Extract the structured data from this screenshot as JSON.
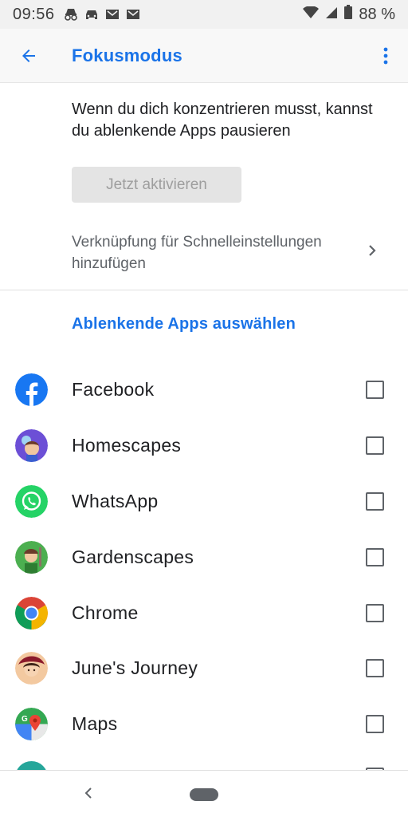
{
  "status_bar": {
    "time": "09:56",
    "battery": "88 %",
    "icons": [
      "incognito-icon",
      "car-icon",
      "gmail-icon",
      "gmail-icon",
      "wifi-icon",
      "signal-icon",
      "battery-icon"
    ]
  },
  "app_bar": {
    "title": "Fokusmodus"
  },
  "main": {
    "description": "Wenn du dich konzentrieren musst, kannst du ablenkende Apps pausieren",
    "activate_button": "Jetzt aktivieren",
    "shortcut_label": "Verknüpfung für Schnelleinstellungen hinzufügen",
    "section_header": "Ablenkende Apps auswählen"
  },
  "apps": [
    {
      "name": "Facebook",
      "icon": "facebook-icon",
      "checked": false
    },
    {
      "name": "Homescapes",
      "icon": "homescapes-icon",
      "checked": false
    },
    {
      "name": "WhatsApp",
      "icon": "whatsapp-icon",
      "checked": false
    },
    {
      "name": "Gardenscapes",
      "icon": "gardenscapes-icon",
      "checked": false
    },
    {
      "name": "Chrome",
      "icon": "chrome-icon",
      "checked": false
    },
    {
      "name": "June's Journey",
      "icon": "junes-journey-icon",
      "checked": false
    },
    {
      "name": "Maps",
      "icon": "maps-icon",
      "checked": false
    }
  ],
  "colors": {
    "accent": "#1a73e8",
    "text_primary": "#202124",
    "text_secondary": "#5f6368"
  }
}
